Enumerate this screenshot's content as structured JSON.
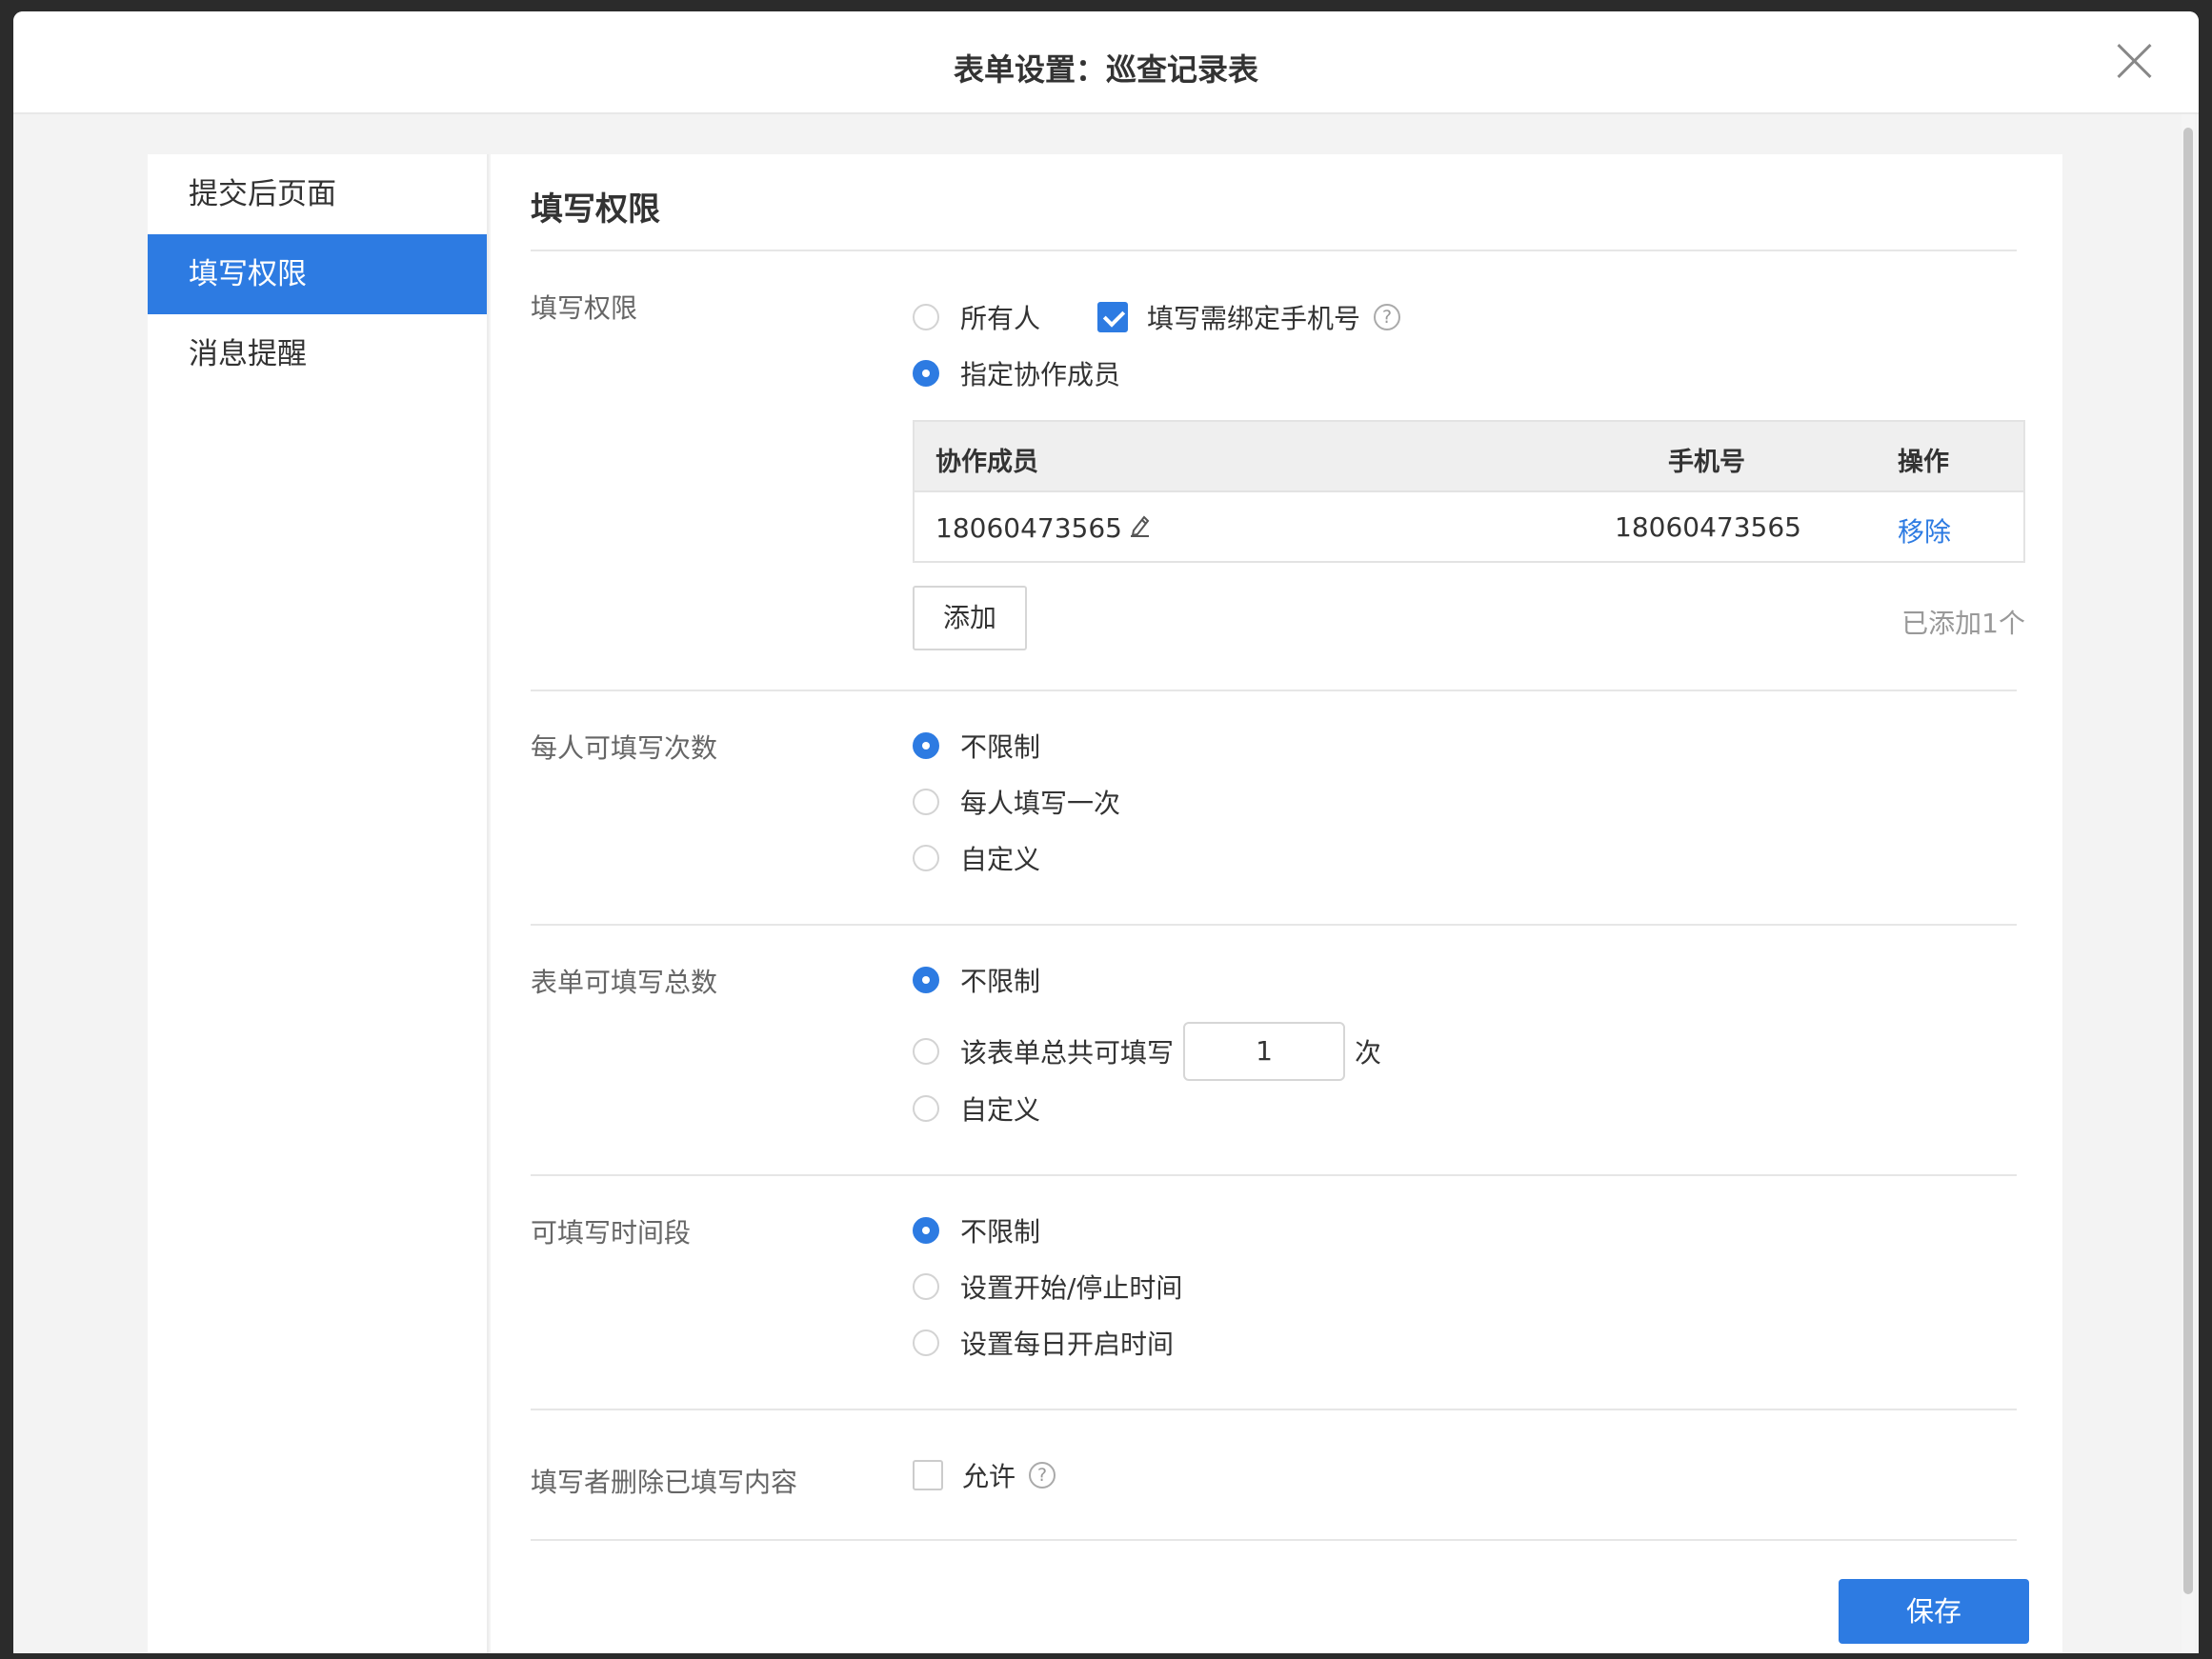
{
  "modal": {
    "title": "表单设置：巡查记录表"
  },
  "sidebar": {
    "items": [
      {
        "label": "提交后页面"
      },
      {
        "label": "填写权限"
      },
      {
        "label": "消息提醒"
      }
    ]
  },
  "main": {
    "heading": "填写权限",
    "permission": {
      "label": "填写权限",
      "options": [
        "所有人",
        "指定协作成员"
      ],
      "selected": "指定协作成员",
      "bind_phone_label": "填写需绑定手机号",
      "bind_phone_checked": true,
      "help_glyph": "?",
      "table": {
        "headers": [
          "协作成员",
          "手机号",
          "操作"
        ],
        "rows": [
          {
            "member": "18060473565",
            "phone": "18060473565",
            "action": "移除"
          }
        ]
      },
      "add_button": "添加",
      "added_count_text": "已添加1个"
    },
    "per_person": {
      "label": "每人可填写次数",
      "options": [
        "不限制",
        "每人填写一次",
        "自定义"
      ],
      "selected": "不限制"
    },
    "total": {
      "label": "表单可填写总数",
      "options": [
        "不限制",
        "该表单总共可填写",
        "自定义"
      ],
      "selected": "不限制",
      "count_value": "1",
      "count_suffix": "次"
    },
    "time": {
      "label": "可填写时间段",
      "options": [
        "不限制",
        "设置开始/停止时间",
        "设置每日开启时间"
      ],
      "selected": "不限制"
    },
    "delete": {
      "label": "填写者删除已填写内容",
      "checkbox_label": "允许",
      "checked": false
    },
    "save_button": "保存"
  },
  "colors": {
    "accent": "#2d7be2"
  }
}
